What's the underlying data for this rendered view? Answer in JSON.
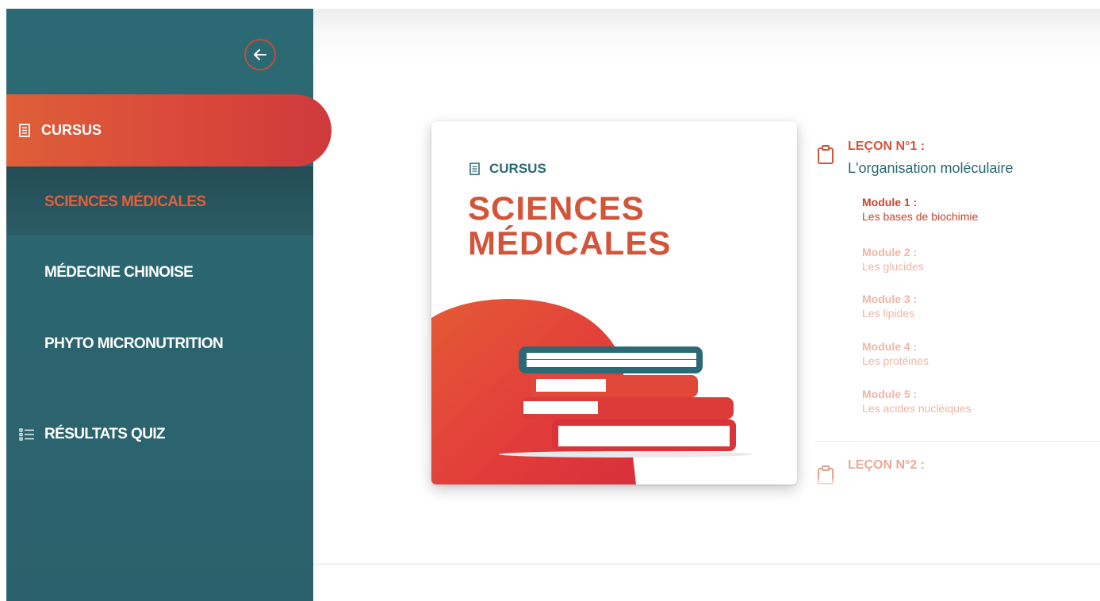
{
  "sidebar": {
    "back_icon": "arrow-left-icon",
    "cursus_label": "CURSUS",
    "items": [
      {
        "label": "SCIENCES MÉDICALES",
        "active": true
      },
      {
        "label": "MÉDECINE CHINOISE",
        "active": false
      },
      {
        "label": "PHYTO MICRONUTRITION",
        "active": false
      }
    ],
    "quiz_label": "RÉSULTATS QUIZ",
    "colors": {
      "bg": "#2b6670",
      "accent": "#d8473a",
      "active_text": "#e0603c"
    }
  },
  "card": {
    "kicker": "CURSUS",
    "title_line1": "SCIENCES",
    "title_line2": "MÉDICALES",
    "image": "books-stack-illustration"
  },
  "lessons": [
    {
      "label": "LEÇON N°1 :",
      "title": "L'organisation moléculaire",
      "icon": "clipboard-icon",
      "modules": [
        {
          "label": "Module 1 :",
          "title": "Les bases de biochimie",
          "active": true
        },
        {
          "label": "Module 2 :",
          "title": "Les glucides",
          "active": false
        },
        {
          "label": "Module 3 :",
          "title": "Les lipides",
          "active": false
        },
        {
          "label": "Module 4 :",
          "title": "Les protéines",
          "active": false
        },
        {
          "label": "Module 5 :",
          "title": "Les acides nucléiques",
          "active": false
        }
      ]
    },
    {
      "label": "LEÇON N°2 :",
      "icon": "clipboard-icon"
    }
  ]
}
